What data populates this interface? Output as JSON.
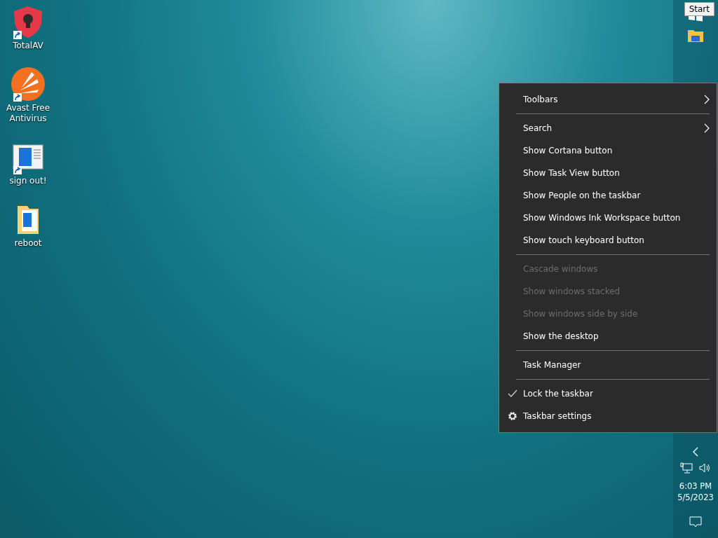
{
  "desktop_icons": [
    {
      "label": "TotalAV",
      "kind": "shield",
      "shortcut": true
    },
    {
      "label": "Avast Free Antivirus",
      "kind": "avast",
      "shortcut": true
    },
    {
      "label": "sign out!",
      "kind": "window",
      "shortcut": true
    },
    {
      "label": "reboot",
      "kind": "folder",
      "shortcut": false
    }
  ],
  "taskbar": {
    "start_tooltip": "Start",
    "time": "6:03 PM",
    "date": "5/5/2023"
  },
  "context_menu": {
    "items": [
      {
        "kind": "item",
        "label": "Toolbars",
        "submenu": true,
        "disabled": false,
        "checked": false
      },
      {
        "kind": "separator"
      },
      {
        "kind": "item",
        "label": "Search",
        "submenu": true,
        "disabled": false,
        "checked": false
      },
      {
        "kind": "item",
        "label": "Show Cortana button",
        "submenu": false,
        "disabled": false,
        "checked": false
      },
      {
        "kind": "item",
        "label": "Show Task View button",
        "submenu": false,
        "disabled": false,
        "checked": false
      },
      {
        "kind": "item",
        "label": "Show People on the taskbar",
        "submenu": false,
        "disabled": false,
        "checked": false
      },
      {
        "kind": "item",
        "label": "Show Windows Ink Workspace button",
        "submenu": false,
        "disabled": false,
        "checked": false
      },
      {
        "kind": "item",
        "label": "Show touch keyboard button",
        "submenu": false,
        "disabled": false,
        "checked": false
      },
      {
        "kind": "separator"
      },
      {
        "kind": "item",
        "label": "Cascade windows",
        "submenu": false,
        "disabled": true,
        "checked": false
      },
      {
        "kind": "item",
        "label": "Show windows stacked",
        "submenu": false,
        "disabled": true,
        "checked": false
      },
      {
        "kind": "item",
        "label": "Show windows side by side",
        "submenu": false,
        "disabled": true,
        "checked": false
      },
      {
        "kind": "item",
        "label": "Show the desktop",
        "submenu": false,
        "disabled": false,
        "checked": false
      },
      {
        "kind": "separator"
      },
      {
        "kind": "item",
        "label": "Task Manager",
        "submenu": false,
        "disabled": false,
        "checked": false
      },
      {
        "kind": "separator"
      },
      {
        "kind": "item",
        "label": "Lock the taskbar",
        "submenu": false,
        "disabled": false,
        "checked": true
      },
      {
        "kind": "settings",
        "label": "Taskbar settings",
        "submenu": false,
        "disabled": false,
        "checked": false
      }
    ]
  }
}
